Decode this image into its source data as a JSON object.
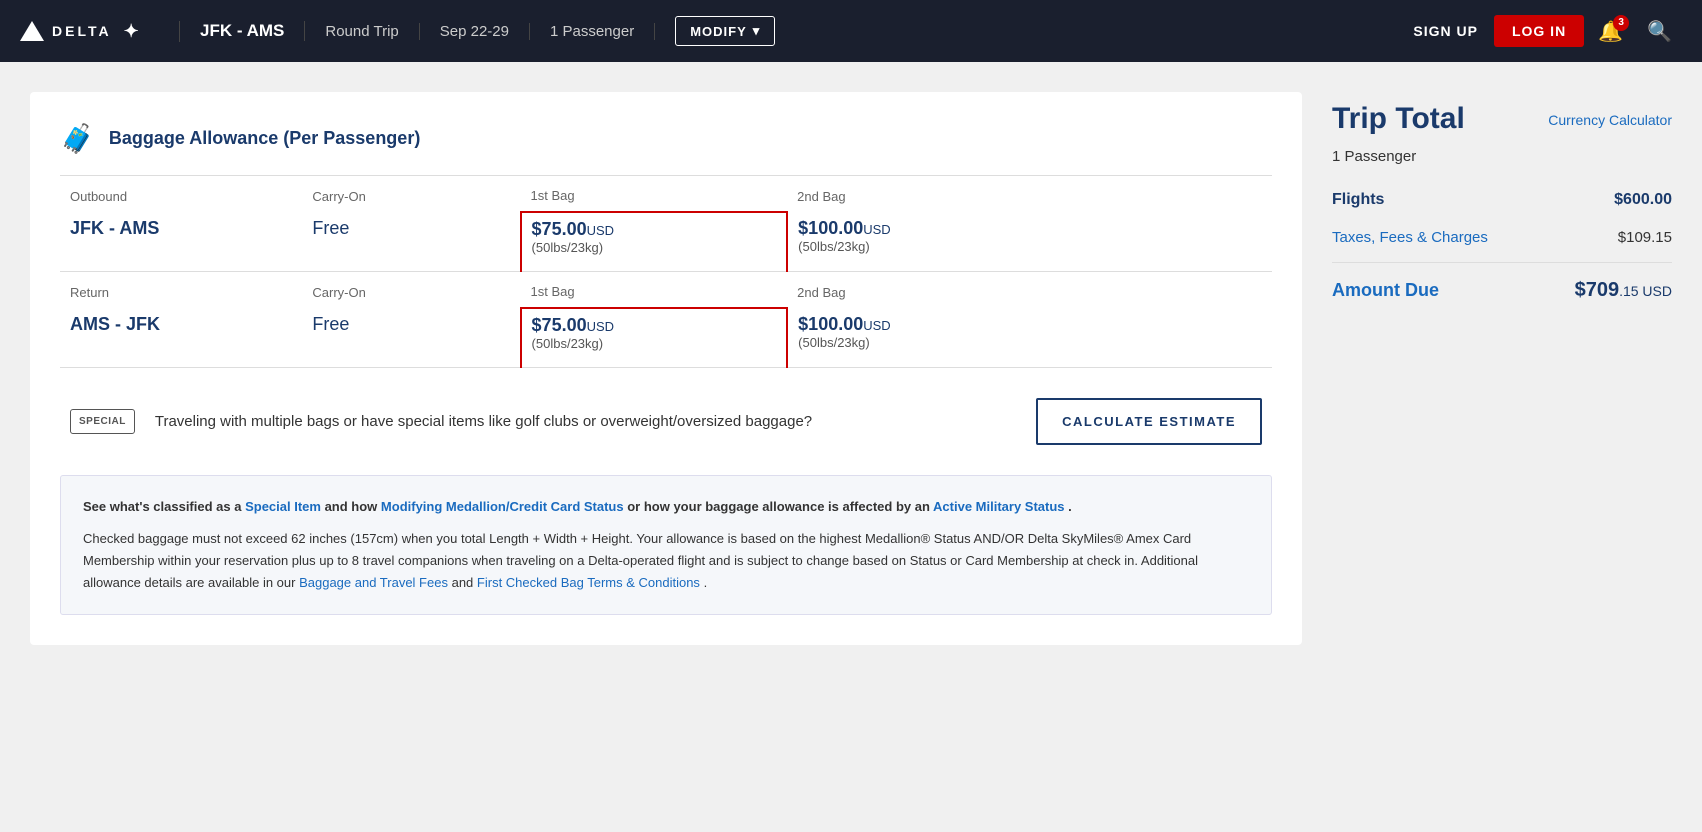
{
  "header": {
    "logo_text": "DELTA",
    "route": "JFK - AMS",
    "trip_type": "Round Trip",
    "dates": "Sep 22-29",
    "passengers": "1 Passenger",
    "modify_label": "MODIFY",
    "signup_label": "SIGN UP",
    "login_label": "LOG IN",
    "bell_count": "3"
  },
  "baggage": {
    "title": "Baggage Allowance (Per Passenger)",
    "outbound_label": "Outbound",
    "return_label": "Return",
    "carryon_label": "Carry-On",
    "first_bag_label": "1st Bag",
    "second_bag_label": "2nd Bag",
    "outbound_route": "JFK - AMS",
    "return_route": "AMS - JFK",
    "carryon_outbound": "Free",
    "carryon_return": "Free",
    "first_bag_price": "$75.00",
    "first_bag_usd": "USD",
    "first_bag_weight": "(50lbs/23kg)",
    "second_bag_price": "$100.00",
    "second_bag_usd": "USD",
    "second_bag_weight": "(50lbs/23kg)"
  },
  "special_section": {
    "icon_label": "SPECIAL",
    "text": "Traveling with multiple bags or have special items like golf clubs or overweight/oversized baggage?",
    "button_label": "CALCULATE ESTIMATE"
  },
  "info_box": {
    "line1_start": "See what's classified as a ",
    "link1": "Special Item",
    "line1_mid": " and how ",
    "link2": "Modifying Medallion/Credit Card Status",
    "line1_end": " or how your baggage allowance is affected by an ",
    "link3": "Active Military Status",
    "line1_period": " .",
    "disclaimer": "Checked baggage must not exceed 62 inches (157cm) when you total Length + Width + Height. Your allowance is based on the highest Medallion® Status AND/OR Delta SkyMiles® Amex Card Membership within your reservation plus up to 8 travel companions when traveling on a Delta-operated flight and is subject to change based on Status or Card Membership at check in. Additional allowance details are available in our ",
    "link4": "Baggage and Travel Fees",
    "disclaimer_mid": " and ",
    "link5": "First Checked Bag Terms & Conditions",
    "disclaimer_end": " ."
  },
  "trip_total": {
    "title": "Trip Total",
    "currency_calc_label": "Currency Calculator",
    "passenger_count": "1 Passenger",
    "flights_label": "Flights",
    "flights_amount": "$600.00",
    "taxes_label": "Taxes, Fees & Charges",
    "taxes_amount": "$109.15",
    "amount_due_label": "Amount Due",
    "amount_due_whole": "$709",
    "amount_due_cents": ".15 USD"
  }
}
